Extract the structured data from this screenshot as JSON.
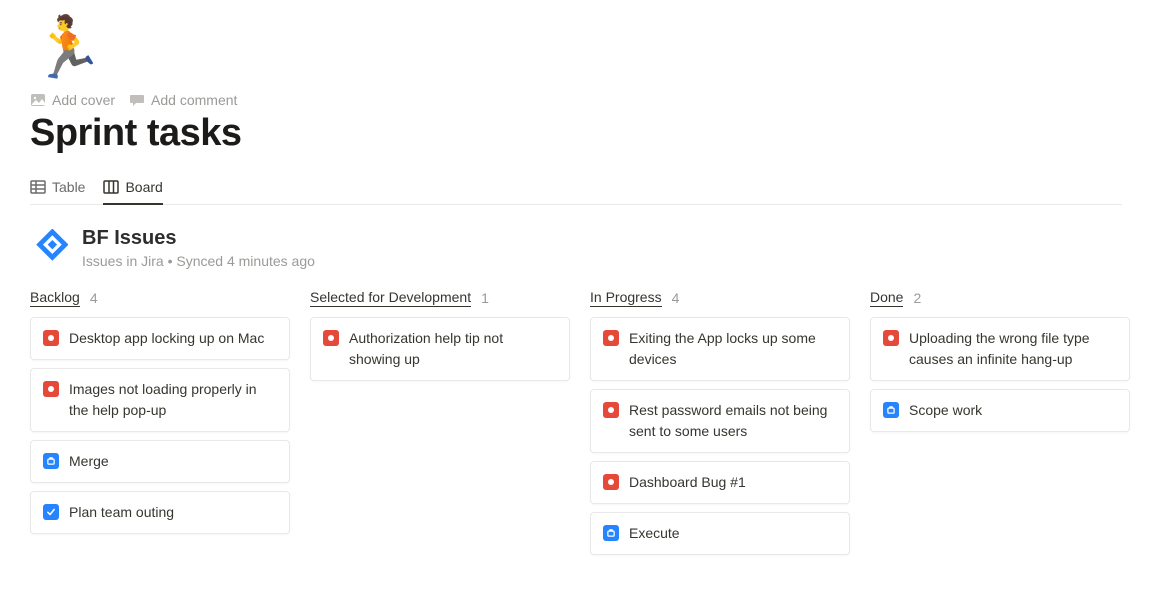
{
  "page": {
    "icon_emoji": "🏃",
    "title": "Sprint tasks",
    "actions": {
      "add_cover": "Add cover",
      "add_comment": "Add comment"
    }
  },
  "views": {
    "table": "Table",
    "board": "Board"
  },
  "db": {
    "title": "BF Issues",
    "subtitle": "Issues in Jira  •  Synced 4 minutes ago"
  },
  "columns": [
    {
      "title": "Backlog",
      "count": "4",
      "cards": [
        {
          "type": "bug",
          "text": "Desktop app locking up on Mac"
        },
        {
          "type": "bug",
          "text": "Images not loading properly in the help pop-up"
        },
        {
          "type": "task",
          "text": "Merge"
        },
        {
          "type": "task-check",
          "text": "Plan team outing"
        }
      ]
    },
    {
      "title": "Selected for Development",
      "count": "1",
      "cards": [
        {
          "type": "bug",
          "text": "Authorization help tip not showing up"
        }
      ]
    },
    {
      "title": "In Progress",
      "count": "4",
      "cards": [
        {
          "type": "bug",
          "text": "Exiting the App locks up some devices"
        },
        {
          "type": "bug",
          "text": "Rest password emails not being sent to some users"
        },
        {
          "type": "bug",
          "text": "Dashboard Bug #1"
        },
        {
          "type": "task",
          "text": "Execute"
        }
      ]
    },
    {
      "title": "Done",
      "count": "2",
      "cards": [
        {
          "type": "bug",
          "text": "Uploading the wrong file type causes an infinite hang-up"
        },
        {
          "type": "task",
          "text": "Scope work"
        }
      ]
    }
  ]
}
